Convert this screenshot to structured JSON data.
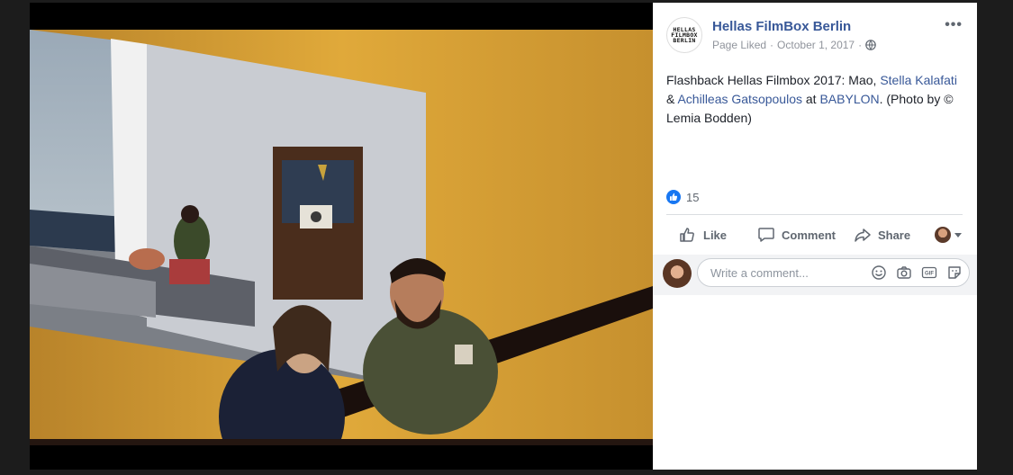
{
  "photo": {
    "description_icon": "photo"
  },
  "post": {
    "page_name": "Hellas FilmBox Berlin",
    "page_logo_text": "HELLAS\nFILMBOX\nBERLIN",
    "page_status": "Page Liked",
    "date": "October 1, 2017",
    "separator": "·",
    "privacy_icon": "globe-icon",
    "more_label": "•••",
    "text": {
      "prefix": "Flashback Hellas Filmbox 2017: Mao, ",
      "mention1": "Stella Kalafati",
      "amp": " & ",
      "mention2": "Achilleas Gatsopoulos",
      "at": " at ",
      "mention3": "BABYLON",
      "suffix": ". (Photo by © Lemia Bodden)"
    },
    "reaction_count": "15"
  },
  "actions": {
    "like": "Like",
    "comment": "Comment",
    "share": "Share"
  },
  "comment": {
    "placeholder": "Write a comment..."
  },
  "colors": {
    "link": "#385898",
    "reaction": "#1877f2"
  }
}
